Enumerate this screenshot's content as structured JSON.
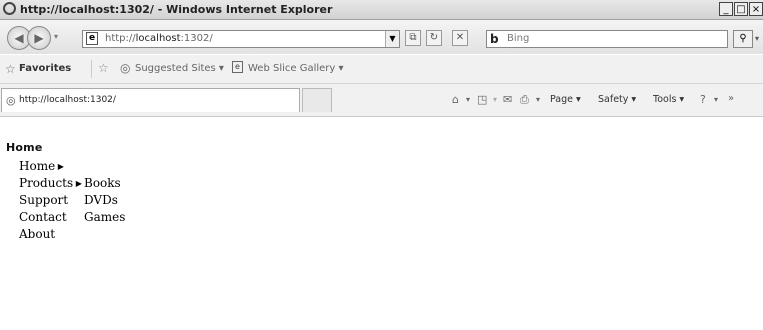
{
  "window": {
    "title": "http://localhost:1302/ - Windows Internet Explorer"
  },
  "toolbar": {
    "address": "http://localhost:1302/",
    "address_prefix": "http://",
    "address_host": "localhost",
    "address_suffix": ":1302/",
    "search_placeholder": "Bing"
  },
  "favorites": {
    "label": "Favorites",
    "items": [
      "Suggested Sites ▾",
      "Web Slice Gallery ▾"
    ]
  },
  "tab": {
    "label": "http://localhost:1302/"
  },
  "commands": [
    "Page ▾",
    "Safety ▾",
    "Tools ▾"
  ],
  "page": {
    "heading": "Home",
    "menu": [
      {
        "label": "Home",
        "submenu_label": ""
      },
      {
        "label": "Products",
        "submenu_label": "Books"
      },
      {
        "label": "Support",
        "submenu_label": "DVDs"
      },
      {
        "label": "Contact",
        "submenu_label": "Games"
      },
      {
        "label": "About",
        "submenu_label": ""
      }
    ]
  }
}
